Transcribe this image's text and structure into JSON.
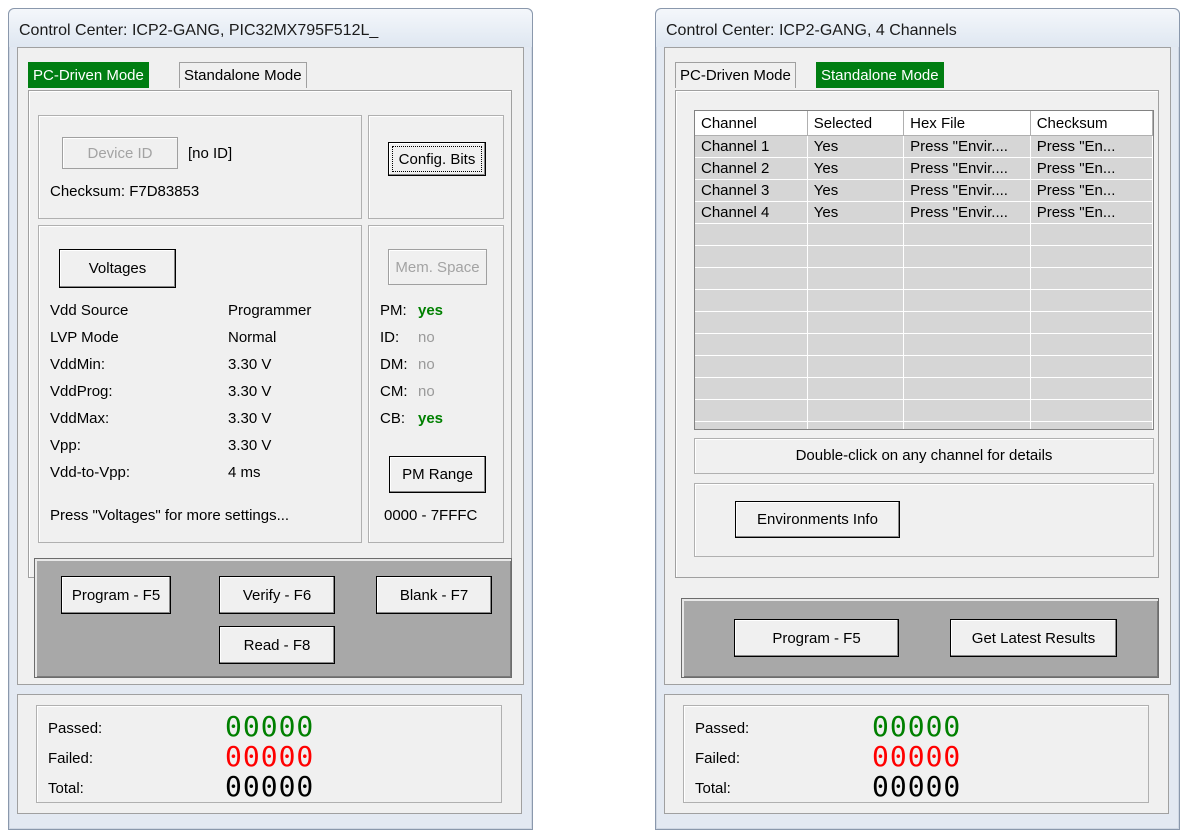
{
  "left_window": {
    "title": "Control Center: ICP2-GANG, PIC32MX795F512L_",
    "tabs": [
      "PC-Driven Mode",
      "Standalone Mode"
    ],
    "device_id_button": "Device ID",
    "device_id_value": "[no ID]",
    "checksum": "Checksum: F7D83853",
    "config_bits_button": "Config. Bits",
    "voltages_button": "Voltages",
    "mem_space_button": "Mem. Space",
    "settings": [
      {
        "label": "Vdd Source",
        "value": "Programmer"
      },
      {
        "label": "LVP Mode",
        "value": "Normal"
      },
      {
        "label": "VddMin:",
        "value": "3.30 V"
      },
      {
        "label": "VddProg:",
        "value": "3.30 V"
      },
      {
        "label": "VddMax:",
        "value": "3.30 V"
      },
      {
        "label": "Vpp:",
        "value": "3.30 V"
      },
      {
        "label": "Vdd-to-Vpp:",
        "value": "4 ms"
      }
    ],
    "memory": [
      {
        "label": "PM:",
        "value": "yes",
        "active": true
      },
      {
        "label": "ID:",
        "value": "no",
        "active": false
      },
      {
        "label": "DM:",
        "value": "no",
        "active": false
      },
      {
        "label": "CM:",
        "value": "no",
        "active": false
      },
      {
        "label": "CB:",
        "value": "yes",
        "active": true
      }
    ],
    "voltages_hint": "Press \"Voltages\" for more settings...",
    "pm_range_button": "PM Range",
    "pm_range_value": "0000 - 7FFFC",
    "actions": {
      "program": "Program - F5",
      "verify": "Verify - F6",
      "blank": "Blank - F7",
      "read": "Read - F8"
    },
    "counters": {
      "passed_label": "Passed:",
      "passed": "00000",
      "failed_label": "Failed:",
      "failed": "00000",
      "total_label": "Total:",
      "total": "00000"
    }
  },
  "right_window": {
    "title": "Control Center: ICP2-GANG, 4 Channels",
    "tabs": [
      "PC-Driven Mode",
      "Standalone Mode"
    ],
    "table": {
      "columns": [
        "Channel",
        "Selected",
        "Hex File",
        "Checksum"
      ],
      "rows": [
        [
          "Channel 1",
          "Yes",
          "Press \"Envir....",
          "Press \"En..."
        ],
        [
          "Channel 2",
          "Yes",
          "Press \"Envir....",
          "Press \"En..."
        ],
        [
          "Channel 3",
          "Yes",
          "Press \"Envir....",
          "Press \"En..."
        ],
        [
          "Channel 4",
          "Yes",
          "Press \"Envir....",
          "Press \"En..."
        ]
      ]
    },
    "hint": "Double-click on any channel for details",
    "environments_button": "Environments Info",
    "actions": {
      "program": "Program - F5",
      "get_results": "Get Latest Results"
    },
    "counters": {
      "passed_label": "Passed:",
      "passed": "00000",
      "failed_label": "Failed:",
      "failed": "00000",
      "total_label": "Total:",
      "total": "00000"
    }
  },
  "colors": {
    "active_tab": "#007e12",
    "passed": "#008000",
    "failed": "#ff0000",
    "total": "#000000",
    "action_panel": "#a8a8a8"
  }
}
